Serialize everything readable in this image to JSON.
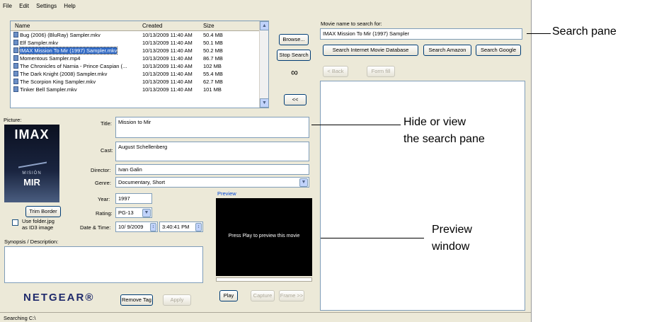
{
  "menu": [
    "File",
    "Edit",
    "Settings",
    "Help"
  ],
  "file_list": {
    "columns": [
      "Name",
      "Created",
      "Size"
    ],
    "rows": [
      {
        "name": "Bug (2006) (BluRay) Sampler.mkv",
        "created": "10/13/2009 11:40 AM",
        "size": "50.4 MB"
      },
      {
        "name": "Elf Sampler.mkv",
        "created": "10/13/2009 11:40 AM",
        "size": "50.1 MB"
      },
      {
        "name": "IMAX Mission To Mir (1997) Sampler.mkv",
        "created": "10/13/2009 11:40 AM",
        "size": "50.2 MB",
        "selected": true
      },
      {
        "name": "Momentous Sampler.mp4",
        "created": "10/13/2009 11:40 AM",
        "size": "86.7 MB"
      },
      {
        "name": "The Chronicles of Narnia - Prince Caspian (...",
        "created": "10/13/2009 11:40 AM",
        "size": "102 MB"
      },
      {
        "name": "The Dark Knight (2008) Sampler.mkv",
        "created": "10/13/2009 11:40 AM",
        "size": "55.4 MB"
      },
      {
        "name": "The Scorpion King Sampler.mkv",
        "created": "10/13/2009 11:40 AM",
        "size": "62.7 MB"
      },
      {
        "name": "Tinker Bell Sampler.mkv",
        "created": "10/13/2009 11:40 AM",
        "size": "101 MB"
      }
    ]
  },
  "buttons": {
    "browse": "Browse...",
    "stop_search": "Stop Search",
    "hide_toggle": "<<",
    "trim_border": "Trim Border",
    "remove_tag": "Remove Tag",
    "apply": "Apply",
    "play": "Play",
    "capture": "Capture",
    "frame": "Frame >>",
    "back": "< Back",
    "form_fill": "Form fill",
    "search_imdb": "Search Internet Movie Database",
    "search_amazon": "Search Amazon",
    "search_google": "Search Google"
  },
  "picture_label": "Picture:",
  "poster": {
    "top_text": "IMAX",
    "mid_text": "MISIÓN",
    "bottom_text": "MIR"
  },
  "use_folder_jpg": "Use folder.jpg as ID3 image",
  "fields": {
    "title_label": "Title:",
    "title": "Mission to Mir",
    "cast_label": "Cast:",
    "cast": "August Schellenberg",
    "director_label": "Director:",
    "director": "Ivan Galin",
    "genre_label": "Genre:",
    "genre": "Documentary, Short",
    "year_label": "Year:",
    "year": "1997",
    "rating_label": "Rating:",
    "rating": "PG-13",
    "datetime_label": "Date & Time:",
    "date": "10/ 9/2009",
    "time": "3:40:41 PM",
    "synopsis_label": "Synopsis / Description:",
    "synopsis": ""
  },
  "preview": {
    "label": "Preview",
    "message": "Press Play to preview this movie"
  },
  "search": {
    "label": "Movie name to search for:",
    "value": "IMAX Mission To Mir (1997) Sampler"
  },
  "brand": "NETGEAR®",
  "status": "Searching C:\\",
  "callouts": {
    "search_pane": "Search pane",
    "hide_view_line1": "Hide or view",
    "hide_view_line2": "the search pane",
    "preview_line1": "Preview",
    "preview_line2": "window"
  }
}
